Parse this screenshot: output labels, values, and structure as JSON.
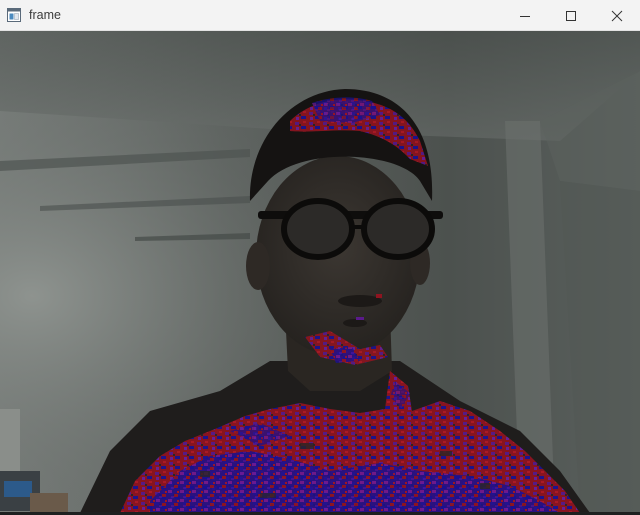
{
  "window": {
    "title": "frame",
    "app_icon": "window-app-icon",
    "controls": {
      "minimize_icon": "minimize-icon",
      "maximize_icon": "maximize-icon",
      "close_icon": "close-icon"
    }
  },
  "frame": {
    "description_icon": "webcam-frame-image",
    "overlay_colors": [
      "#9a1520",
      "#5a1a8a",
      "#1a1090"
    ]
  }
}
